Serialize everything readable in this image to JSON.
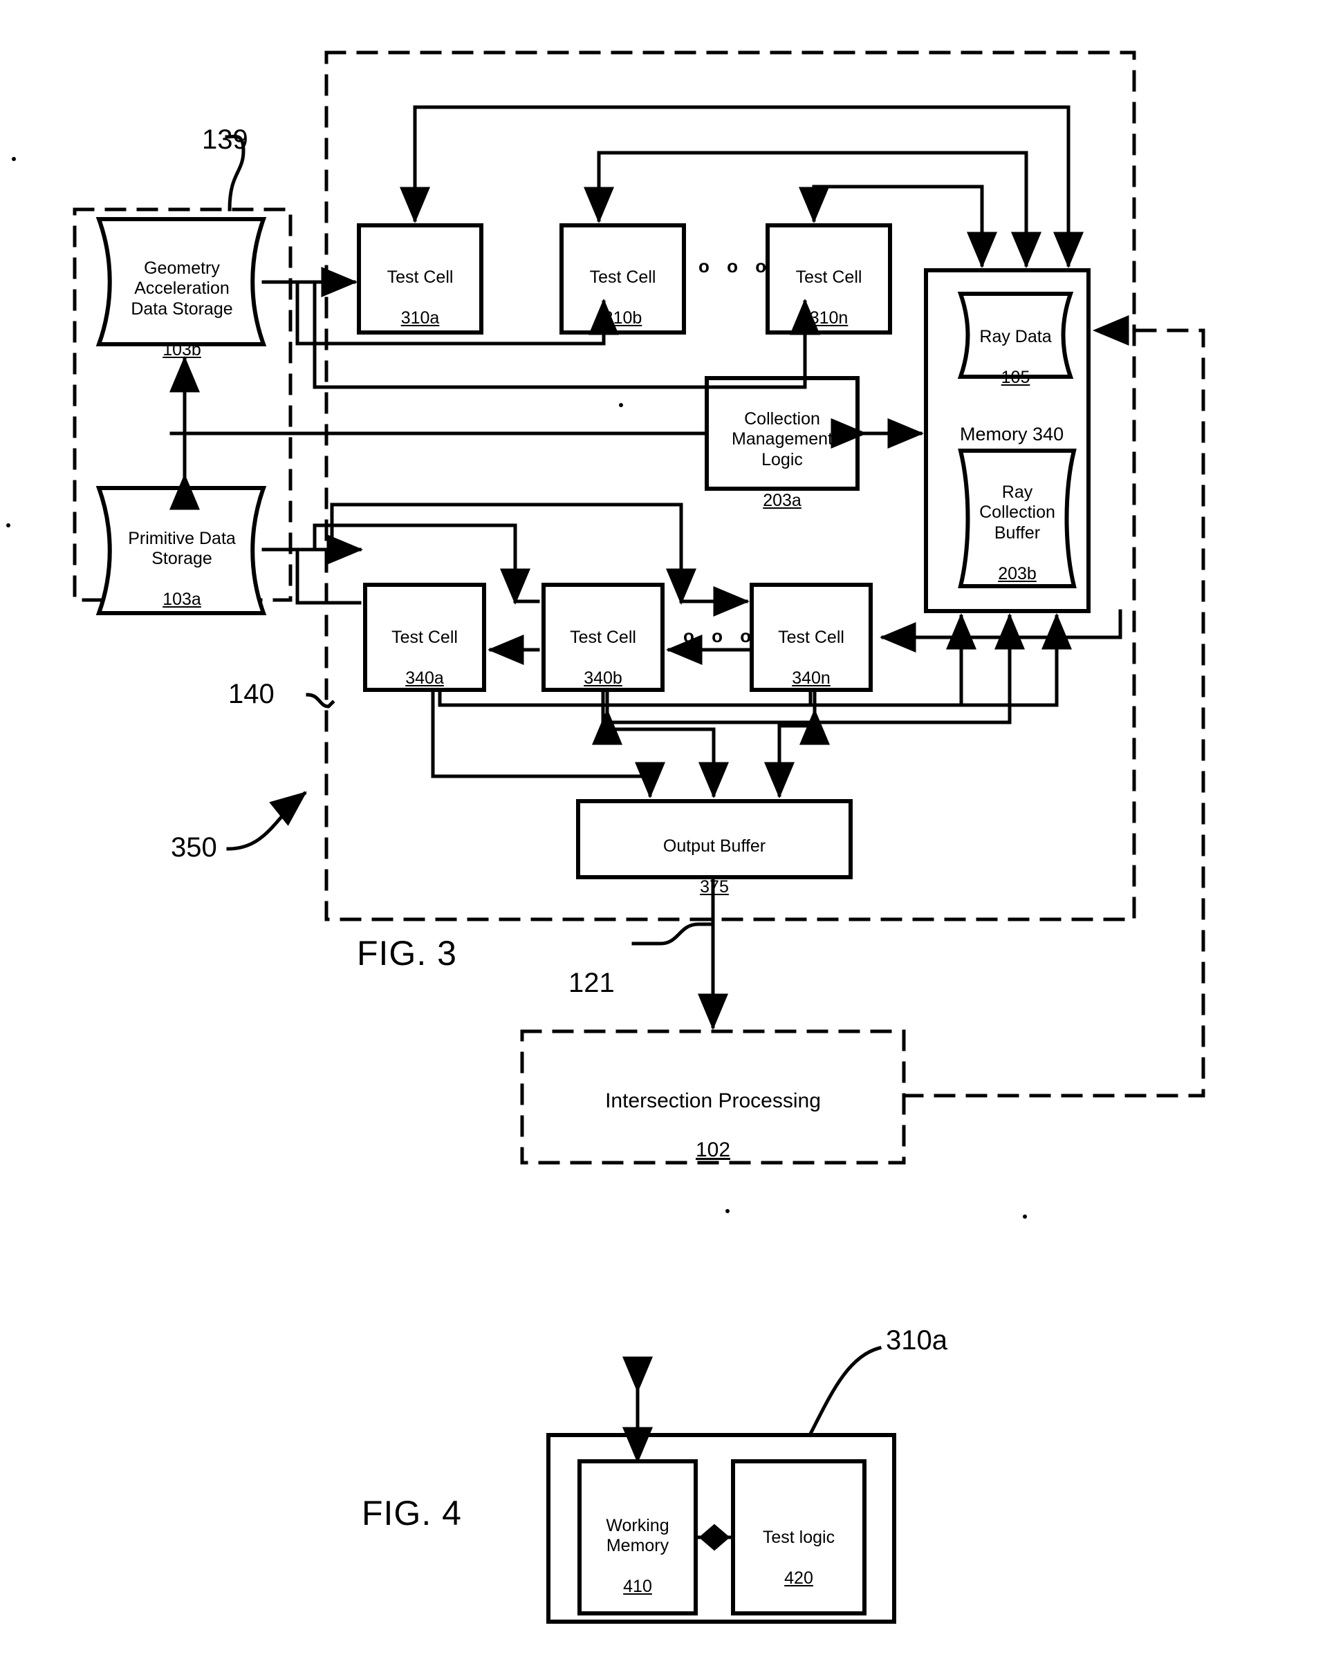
{
  "figures": [
    {
      "id": "fig3",
      "label": "FIG. 3"
    },
    {
      "id": "fig4",
      "label": "FIG. 4"
    }
  ],
  "reference_numerals": [
    {
      "id": "ref-139",
      "text": "139"
    },
    {
      "id": "ref-140",
      "text": "140"
    },
    {
      "id": "ref-350",
      "text": "350"
    },
    {
      "id": "ref-121",
      "text": "121"
    },
    {
      "id": "ref-310a-fig4",
      "text": "310a"
    }
  ],
  "fig3": {
    "storage_group": {
      "geometry_storage": {
        "name": "Geometry\nAcceleration\nData Storage",
        "number": "103b"
      },
      "primitive_storage": {
        "name": "Primitive Data\nStorage",
        "number": "103a"
      }
    },
    "top_test_cells": [
      {
        "name": "Test Cell",
        "number": "310a"
      },
      {
        "name": "Test Cell",
        "number": "310b"
      },
      {
        "name": "Test Cell",
        "number": "310n"
      }
    ],
    "bottom_test_cells": [
      {
        "name": "Test Cell",
        "number": "340a"
      },
      {
        "name": "Test Cell",
        "number": "340b"
      },
      {
        "name": "Test Cell",
        "number": "340n"
      }
    ],
    "ellipsis": "o o o",
    "collection_management_logic": {
      "name": "Collection\nManagement\nLogic",
      "number": "203a"
    },
    "memory": {
      "label": "Memory",
      "number": "340",
      "ray_data": {
        "name": "Ray Data",
        "number": "105"
      },
      "ray_collection_buffer": {
        "name": "Ray\nCollection\nBuffer",
        "number": "203b"
      }
    },
    "output_buffer": {
      "name": "Output Buffer",
      "number": "375"
    },
    "intersection_processing": {
      "name": "Intersection Processing",
      "number": "102"
    }
  },
  "fig4": {
    "test_cell": {
      "number": "310a"
    },
    "working_memory": {
      "name": "Working\nMemory",
      "number": "410"
    },
    "test_logic": {
      "name": "Test logic",
      "number": "420"
    }
  },
  "colors": {
    "stroke": "#000000",
    "background": "#ffffff"
  }
}
